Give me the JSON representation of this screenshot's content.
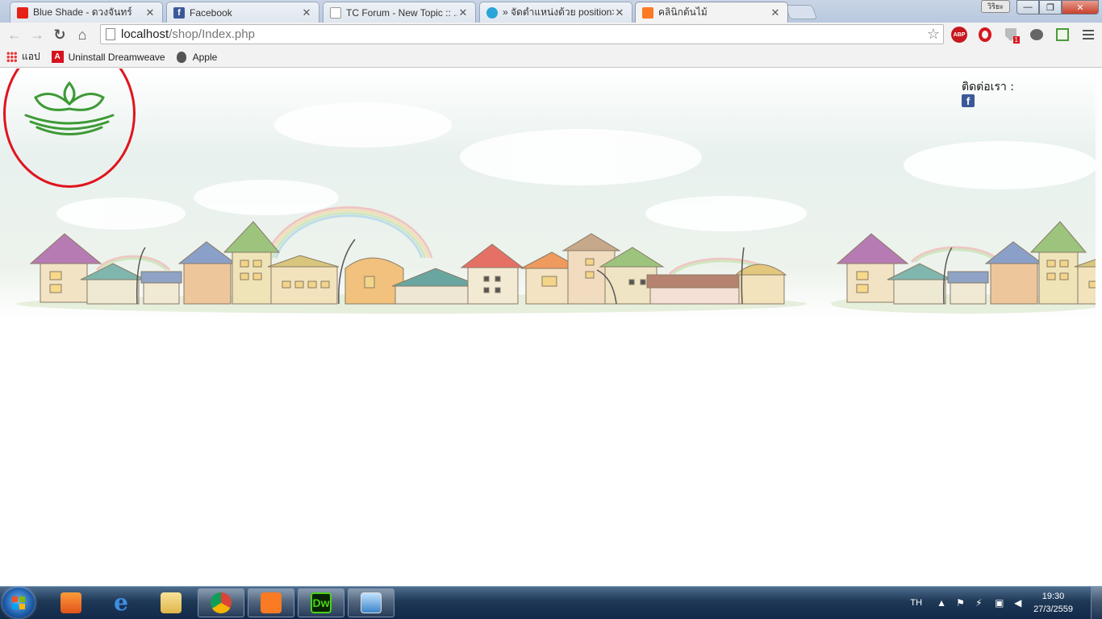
{
  "browser": {
    "tabs": [
      {
        "title": "Blue Shade - ดวงจันทร์",
        "favicon": "youtube-icon",
        "active": false
      },
      {
        "title": "Facebook",
        "favicon": "facebook-icon",
        "active": false
      },
      {
        "title": "TC Forum - New Topic :: ...",
        "favicon": "page-icon",
        "active": false
      },
      {
        "title": "» จัดตำแหน่งด้วย position>",
        "favicon": "blog-icon",
        "active": false
      },
      {
        "title": "คลินิกต้นไม้",
        "favicon": "xampp-icon",
        "active": true
      }
    ],
    "profile_label": "วิริยะ",
    "window_controls": {
      "minimize": "—",
      "maximize": "❐",
      "close": "✕"
    },
    "toolbar": {
      "back": "←",
      "forward": "→",
      "reload": "↻",
      "home": "⌂",
      "url_host": "localhost",
      "url_path": "/shop/Index.php",
      "extensions": [
        "adblock-plus-icon",
        "opera-icon",
        "shield-extension-icon",
        "cloud-extension-icon",
        "sheet-extension-icon"
      ],
      "abp_label": "ABP",
      "badge_count": "1"
    },
    "bookmarks": [
      {
        "label": "แอป",
        "icon": "apps-grid-icon"
      },
      {
        "label": "Uninstall Dreamweave",
        "icon": "adobe-icon"
      },
      {
        "label": "Apple",
        "icon": "apple-icon"
      }
    ]
  },
  "page": {
    "contact_label": "ติดต่อเรา :",
    "facebook_glyph": "f",
    "logo": "leaf-logo-icon",
    "annotation_color": "#e0141e"
  },
  "taskbar": {
    "apps": [
      "media-player-icon",
      "internet-explorer-icon",
      "file-explorer-icon",
      "chrome-icon",
      "xampp-icon",
      "dreamweaver-icon",
      "picture-viewer-icon"
    ],
    "dreamweaver_label": "Dw",
    "language": "TH",
    "time": "19:30",
    "date": "27/3/2559"
  }
}
